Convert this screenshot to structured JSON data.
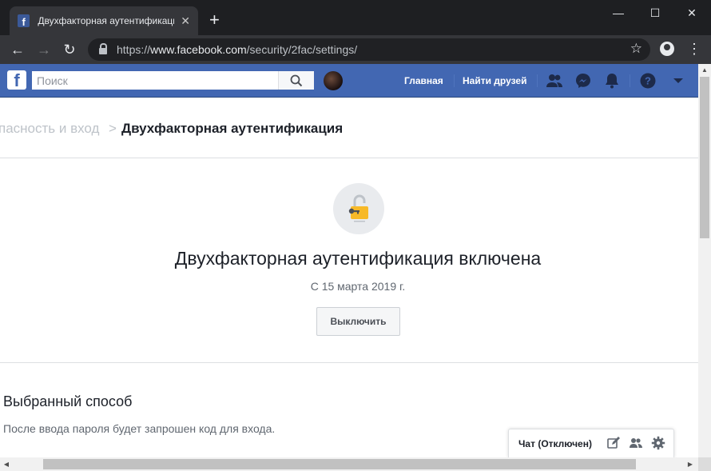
{
  "browser": {
    "tab": {
      "title": "Двухфакторная аутентификация",
      "favicon": "f",
      "close_label": "✕"
    },
    "new_tab_label": "+",
    "window": {
      "minimize": "—",
      "maximize": "☐",
      "close": "✕"
    },
    "url": {
      "scheme": "https://",
      "host": "www.facebook.com",
      "path": "/security/2fac/settings/"
    }
  },
  "facebook": {
    "logo": "f",
    "search": {
      "placeholder": "Поиск",
      "value": ""
    },
    "nav": {
      "home": "Главная",
      "find_friends": "Найти друзей"
    },
    "icons": [
      "friend-requests-icon",
      "messenger-icon",
      "notifications-icon",
      "help-icon",
      "account-menu-icon"
    ],
    "brand_color": "#4267b2"
  },
  "breadcrumb": {
    "previous": "пасность и вход",
    "separator": ">",
    "current": "Двухфакторная аутентификация"
  },
  "status": {
    "icon": "unlocked-padlock-key-icon",
    "title": "Двухфакторная аутентификация включена",
    "date": "С 15 марта 2019 г.",
    "disable_button": "Выключить"
  },
  "method": {
    "title": "Выбранный способ",
    "description": "После ввода пароля будет запрошен код для входа."
  },
  "chat": {
    "label": "Чат (Отключен)",
    "icons": [
      "compose-icon",
      "group-chat-icon",
      "settings-gear-icon"
    ]
  }
}
